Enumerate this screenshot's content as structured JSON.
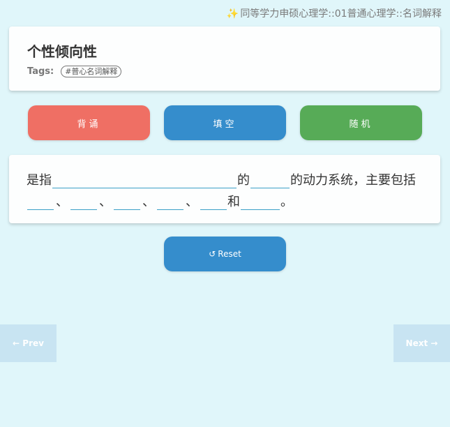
{
  "breadcrumb": {
    "icon": "sparkles-icon",
    "text": "同等学力申硕心理学::01普通心理学::名词解释"
  },
  "card": {
    "title": "个性倾向性",
    "tags_label": "Tags:",
    "tags": [
      "#普心名词解释"
    ]
  },
  "modes": {
    "recite": "背诵",
    "fill": "填空",
    "random": "随机"
  },
  "cloze": {
    "prefix": "是指",
    "mid1": "的",
    "mid2": "的动力系统，主要包括",
    "sep": "、",
    "and": "和",
    "end": "。"
  },
  "reset": {
    "icon": "↺",
    "label": "Reset"
  },
  "nav": {
    "prev": "← Prev",
    "next": "Next →"
  },
  "colors": {
    "background": "#e0f6fa",
    "red": "#ef6f64",
    "blue": "#358dcc",
    "green": "#57ab57",
    "nav": "#c8e4f2"
  }
}
